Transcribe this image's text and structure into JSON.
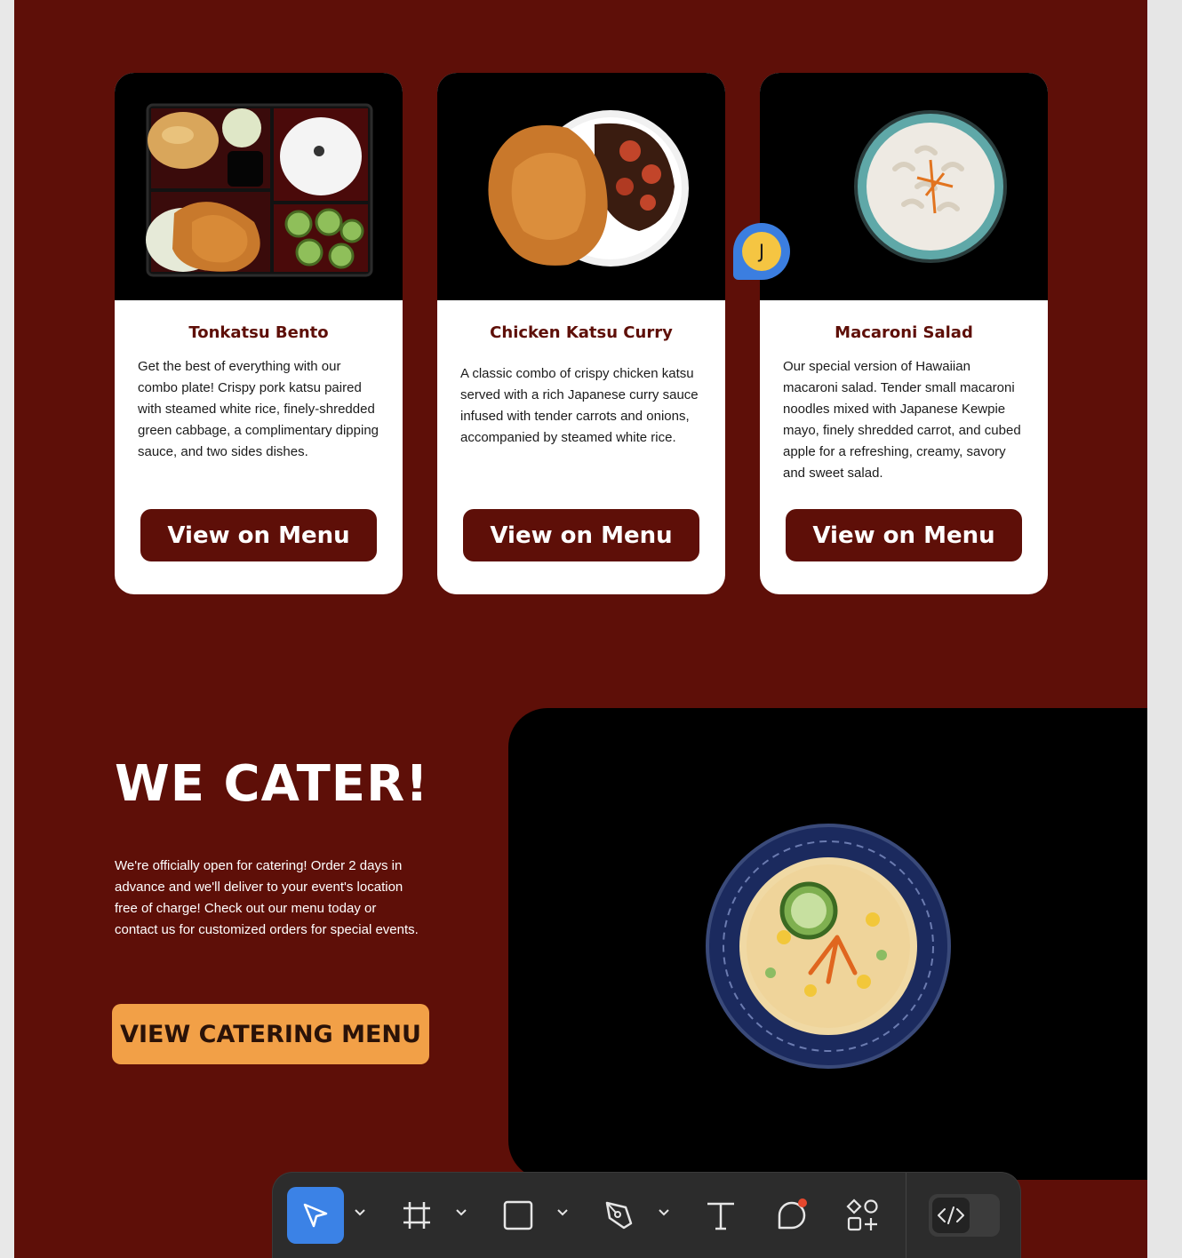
{
  "menu_cards": [
    {
      "title": "Tonkatsu Bento",
      "description": "Get the best of everything with our combo plate! Crispy pork katsu paired with steamed white rice, finely-shredded green cabbage, a complimentary dipping sauce, and two sides dishes.",
      "button_label": "View on Menu",
      "photo_icon": "bento-box-photo"
    },
    {
      "title": "Chicken Katsu Curry",
      "description": "A classic combo of crispy chicken katsu served with a rich Japanese curry sauce infused with tender carrots and onions, accompanied by steamed white rice.",
      "button_label": "View on Menu",
      "photo_icon": "curry-plate-photo"
    },
    {
      "title": "Macaroni  Salad",
      "description": "Our special version of Hawaiian macaroni salad. Tender small macaroni noodles mixed with Japanese Kewpie mayo, finely shredded carrot, and cubed apple for a refreshing, creamy, savory and sweet salad.",
      "button_label": "View on Menu",
      "photo_icon": "macaroni-bowl-photo"
    }
  ],
  "catering": {
    "heading": "WE CATER!",
    "description": "We're officially open for catering! Order 2 days in advance and we'll deliver to your event's location free of charge! Check out our menu today or contact us for customized orders for special events.",
    "button_label": "VIEW CATERING MENU",
    "photo_icon": "potato-salad-bowl-photo"
  },
  "collaborator": {
    "initial": "J"
  },
  "toolbar": {
    "tools": [
      {
        "name": "move-tool",
        "icon": "cursor-arrow-icon",
        "active": true
      },
      {
        "name": "frame-tool",
        "icon": "frame-hash-icon",
        "active": false
      },
      {
        "name": "shape-tool",
        "icon": "rectangle-icon",
        "active": false
      },
      {
        "name": "pen-tool",
        "icon": "pen-nib-icon",
        "active": false
      },
      {
        "name": "text-tool",
        "icon": "text-t-icon",
        "active": false
      },
      {
        "name": "comment-tool",
        "icon": "comment-bubble-icon",
        "active": false
      },
      {
        "name": "actions-tool",
        "icon": "shapes-plus-icon",
        "active": false
      }
    ],
    "dev_mode_icon": "code-brackets-icon",
    "colors": {
      "active": "#3b82e6",
      "background": "#2c2c2c"
    }
  },
  "colors": {
    "frame_background": "#5e0f08",
    "card_button": "#5e0f08",
    "catering_button": "#f2a047",
    "avatar_ring": "#3b7ee0",
    "avatar_fill": "#f5c542"
  }
}
